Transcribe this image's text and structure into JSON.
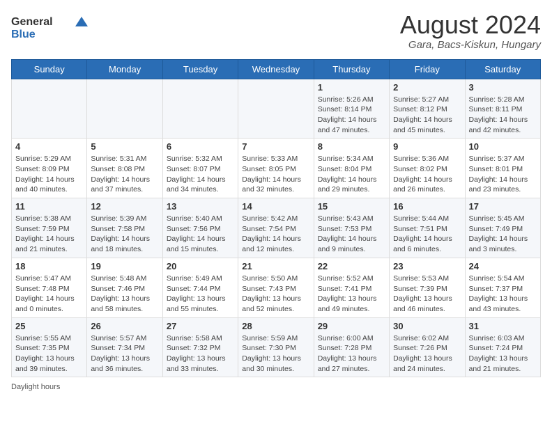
{
  "logo": {
    "general": "General",
    "blue": "Blue"
  },
  "header": {
    "month_year": "August 2024",
    "location": "Gara, Bacs-Kiskun, Hungary"
  },
  "days_of_week": [
    "Sunday",
    "Monday",
    "Tuesday",
    "Wednesday",
    "Thursday",
    "Friday",
    "Saturday"
  ],
  "weeks": [
    [
      {
        "day": "",
        "info": ""
      },
      {
        "day": "",
        "info": ""
      },
      {
        "day": "",
        "info": ""
      },
      {
        "day": "",
        "info": ""
      },
      {
        "day": "1",
        "info": "Sunrise: 5:26 AM\nSunset: 8:14 PM\nDaylight: 14 hours\nand 47 minutes."
      },
      {
        "day": "2",
        "info": "Sunrise: 5:27 AM\nSunset: 8:12 PM\nDaylight: 14 hours\nand 45 minutes."
      },
      {
        "day": "3",
        "info": "Sunrise: 5:28 AM\nSunset: 8:11 PM\nDaylight: 14 hours\nand 42 minutes."
      }
    ],
    [
      {
        "day": "4",
        "info": "Sunrise: 5:29 AM\nSunset: 8:09 PM\nDaylight: 14 hours\nand 40 minutes."
      },
      {
        "day": "5",
        "info": "Sunrise: 5:31 AM\nSunset: 8:08 PM\nDaylight: 14 hours\nand 37 minutes."
      },
      {
        "day": "6",
        "info": "Sunrise: 5:32 AM\nSunset: 8:07 PM\nDaylight: 14 hours\nand 34 minutes."
      },
      {
        "day": "7",
        "info": "Sunrise: 5:33 AM\nSunset: 8:05 PM\nDaylight: 14 hours\nand 32 minutes."
      },
      {
        "day": "8",
        "info": "Sunrise: 5:34 AM\nSunset: 8:04 PM\nDaylight: 14 hours\nand 29 minutes."
      },
      {
        "day": "9",
        "info": "Sunrise: 5:36 AM\nSunset: 8:02 PM\nDaylight: 14 hours\nand 26 minutes."
      },
      {
        "day": "10",
        "info": "Sunrise: 5:37 AM\nSunset: 8:01 PM\nDaylight: 14 hours\nand 23 minutes."
      }
    ],
    [
      {
        "day": "11",
        "info": "Sunrise: 5:38 AM\nSunset: 7:59 PM\nDaylight: 14 hours\nand 21 minutes."
      },
      {
        "day": "12",
        "info": "Sunrise: 5:39 AM\nSunset: 7:58 PM\nDaylight: 14 hours\nand 18 minutes."
      },
      {
        "day": "13",
        "info": "Sunrise: 5:40 AM\nSunset: 7:56 PM\nDaylight: 14 hours\nand 15 minutes."
      },
      {
        "day": "14",
        "info": "Sunrise: 5:42 AM\nSunset: 7:54 PM\nDaylight: 14 hours\nand 12 minutes."
      },
      {
        "day": "15",
        "info": "Sunrise: 5:43 AM\nSunset: 7:53 PM\nDaylight: 14 hours\nand 9 minutes."
      },
      {
        "day": "16",
        "info": "Sunrise: 5:44 AM\nSunset: 7:51 PM\nDaylight: 14 hours\nand 6 minutes."
      },
      {
        "day": "17",
        "info": "Sunrise: 5:45 AM\nSunset: 7:49 PM\nDaylight: 14 hours\nand 3 minutes."
      }
    ],
    [
      {
        "day": "18",
        "info": "Sunrise: 5:47 AM\nSunset: 7:48 PM\nDaylight: 14 hours\nand 0 minutes."
      },
      {
        "day": "19",
        "info": "Sunrise: 5:48 AM\nSunset: 7:46 PM\nDaylight: 13 hours\nand 58 minutes."
      },
      {
        "day": "20",
        "info": "Sunrise: 5:49 AM\nSunset: 7:44 PM\nDaylight: 13 hours\nand 55 minutes."
      },
      {
        "day": "21",
        "info": "Sunrise: 5:50 AM\nSunset: 7:43 PM\nDaylight: 13 hours\nand 52 minutes."
      },
      {
        "day": "22",
        "info": "Sunrise: 5:52 AM\nSunset: 7:41 PM\nDaylight: 13 hours\nand 49 minutes."
      },
      {
        "day": "23",
        "info": "Sunrise: 5:53 AM\nSunset: 7:39 PM\nDaylight: 13 hours\nand 46 minutes."
      },
      {
        "day": "24",
        "info": "Sunrise: 5:54 AM\nSunset: 7:37 PM\nDaylight: 13 hours\nand 43 minutes."
      }
    ],
    [
      {
        "day": "25",
        "info": "Sunrise: 5:55 AM\nSunset: 7:35 PM\nDaylight: 13 hours\nand 39 minutes."
      },
      {
        "day": "26",
        "info": "Sunrise: 5:57 AM\nSunset: 7:34 PM\nDaylight: 13 hours\nand 36 minutes."
      },
      {
        "day": "27",
        "info": "Sunrise: 5:58 AM\nSunset: 7:32 PM\nDaylight: 13 hours\nand 33 minutes."
      },
      {
        "day": "28",
        "info": "Sunrise: 5:59 AM\nSunset: 7:30 PM\nDaylight: 13 hours\nand 30 minutes."
      },
      {
        "day": "29",
        "info": "Sunrise: 6:00 AM\nSunset: 7:28 PM\nDaylight: 13 hours\nand 27 minutes."
      },
      {
        "day": "30",
        "info": "Sunrise: 6:02 AM\nSunset: 7:26 PM\nDaylight: 13 hours\nand 24 minutes."
      },
      {
        "day": "31",
        "info": "Sunrise: 6:03 AM\nSunset: 7:24 PM\nDaylight: 13 hours\nand 21 minutes."
      }
    ]
  ],
  "legend": {
    "label": "Daylight hours"
  }
}
